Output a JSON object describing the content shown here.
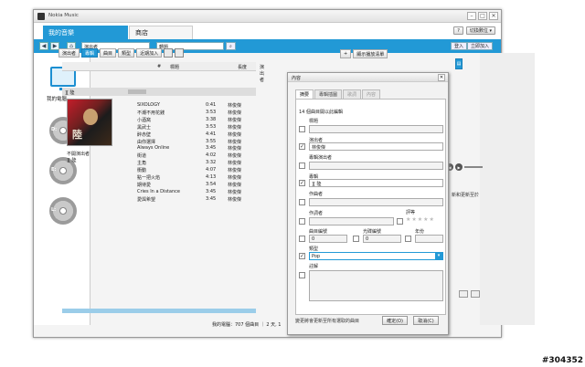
{
  "window": {
    "title": "Nokia Music",
    "controls": [
      "–",
      "□",
      "✕"
    ]
  },
  "tabs": {
    "my_music": "我的音樂",
    "store": "商店"
  },
  "top_right": {
    "help": "?",
    "device_btn": "切換數位 ▾"
  },
  "nav": {
    "field1": "演出者",
    "field2": "轉題",
    "search_icon": "⌕",
    "login": "登入",
    "signup": "立即加入"
  },
  "left": {
    "computer_label": "我的電腦",
    "devices": [
      "D:",
      "E:",
      "L:"
    ]
  },
  "toolbar": {
    "btn1": "演出者",
    "btn2": "專輯",
    "btn3": "曲目",
    "btn4": "類型",
    "btn5": "近期加入",
    "add": "+",
    "show_list": "顯示播放清單"
  },
  "list": {
    "headers": {
      "num": "#",
      "title": "標題",
      "length": "長度",
      "artist": "演出者"
    },
    "album_name": "][ 陸"
  },
  "album": {
    "cover_text": "陸",
    "info1": "不開演出者",
    "info2": "][ 陸"
  },
  "tracks": [
    {
      "title": "SIXOLOGY",
      "length": "0:41",
      "artist": "林俊傑"
    },
    {
      "title": "不潮不用花錢",
      "length": "3:53",
      "artist": "林俊傑"
    },
    {
      "title": "小酒窩",
      "length": "3:38",
      "artist": "林俊傑"
    },
    {
      "title": "黑武士",
      "length": "3:53",
      "artist": "林俊傑"
    },
    {
      "title": "醉赤壁",
      "length": "4:41",
      "artist": "林俊傑"
    },
    {
      "title": "由你選擇",
      "length": "3:55",
      "artist": "林俊傑"
    },
    {
      "title": "Always Online",
      "length": "3:45",
      "artist": "林俊傑"
    },
    {
      "title": "街道",
      "length": "4:02",
      "artist": "林俊傑"
    },
    {
      "title": "主角",
      "length": "3:32",
      "artist": "林俊傑"
    },
    {
      "title": "衝動",
      "length": "4:07",
      "artist": "林俊傑"
    },
    {
      "title": "點一把火焰",
      "length": "4:13",
      "artist": "林俊傑"
    },
    {
      "title": "期待愛",
      "length": "3:54",
      "artist": "林俊傑"
    },
    {
      "title": "Cries In a Distance",
      "length": "3:45",
      "artist": "林俊傑"
    },
    {
      "title": "愛與希望",
      "length": "3:45",
      "artist": "林俊傑"
    }
  ],
  "status": {
    "text": "我的電腦：707 個曲目 ｜ 2 天, 1"
  },
  "right": {
    "big_btn": "▤",
    "hint": "新和更新至於",
    "player_icons": [
      "◀",
      "▶"
    ]
  },
  "dialog": {
    "title": "內容",
    "close": "✕",
    "tabs": [
      "摘要",
      "專輯插圖",
      "歌詞",
      "內容"
    ],
    "count_text": "14 個曲目開以此編輯",
    "fields": {
      "title_label": "標題",
      "title_val": "",
      "artist_label": "演出者",
      "artist_val": "林俊傑",
      "album_artist_label": "專輯演出者",
      "album_artist_val": "",
      "album_label": "專輯",
      "album_val": "][ 陸",
      "composer_label": "作曲者",
      "composer_val": "",
      "lyricist_label": "作詞者",
      "lyricist_val": "",
      "rating_label": "評等",
      "rating_val": "★★★★★",
      "track_label": "曲目編號",
      "track_val": "0",
      "disc_label": "光碟編號",
      "disc_val": "0",
      "year_label": "年份",
      "year_val": "",
      "genre_label": "類型",
      "genre_val": "Pop",
      "comment_label": "註解",
      "comment_val": ""
    },
    "footer": "變更將會更新至所有選取的曲目",
    "ok": "確定(O)",
    "cancel": "取消(C)"
  },
  "watermark": "#304352"
}
